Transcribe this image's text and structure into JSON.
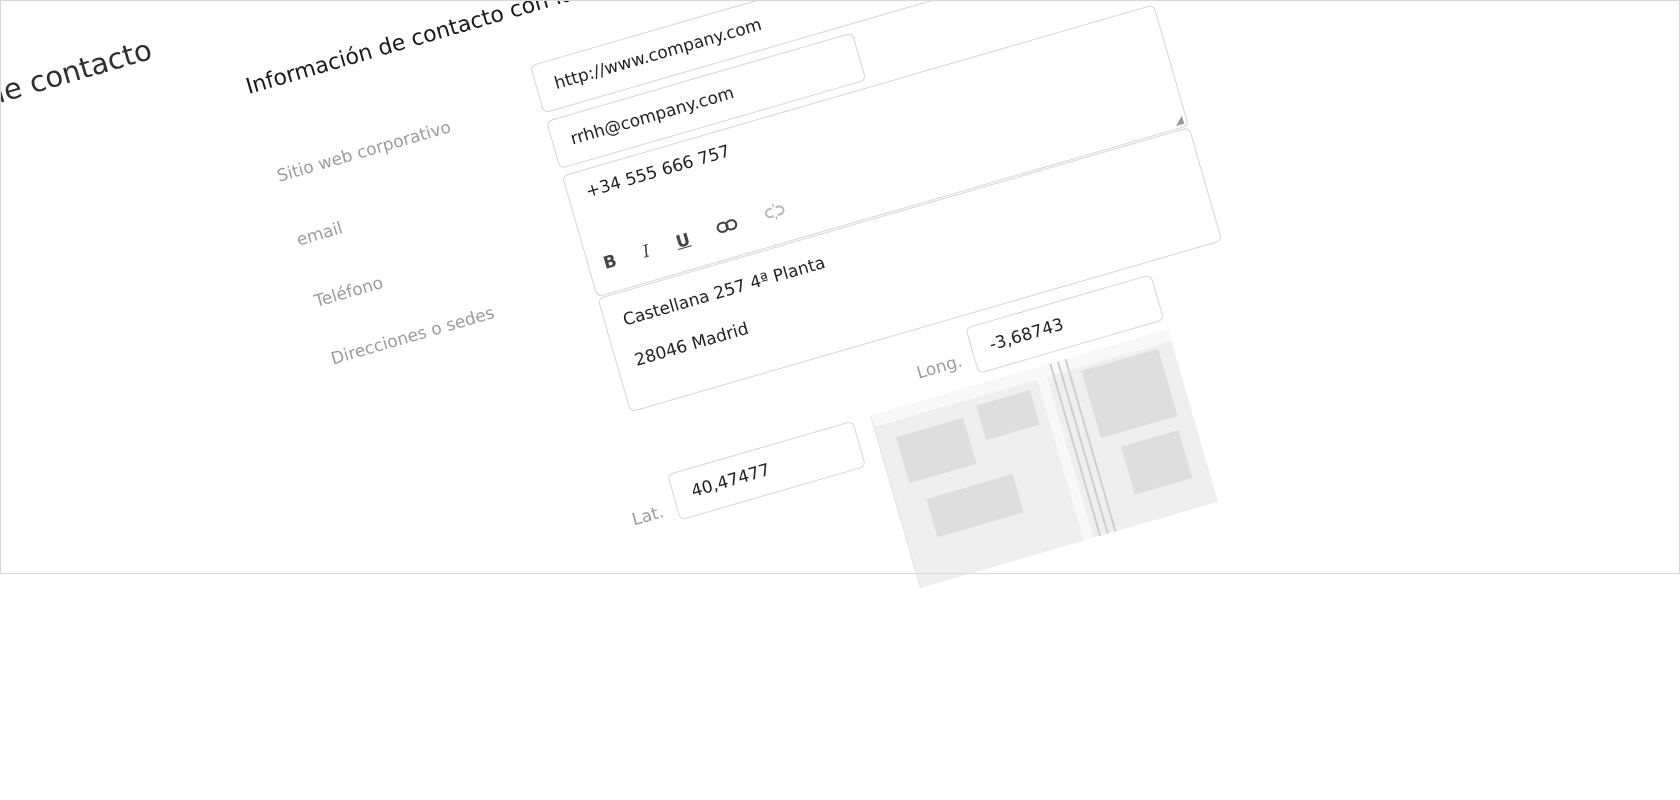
{
  "page": {
    "title": "de contacto"
  },
  "section": {
    "title": "Información de contacto con la empresa"
  },
  "form": {
    "website": {
      "label": "Sitio web corporativo",
      "value": "http://www.company.com"
    },
    "email": {
      "label": "email",
      "value": "rrhh@company.com"
    },
    "phone": {
      "label": "Teléfono",
      "value": "+34 555 666 757"
    },
    "address": {
      "label": "Direcciones o sedes",
      "toolbar": {
        "bold": "B",
        "italic": "I",
        "underline": "U"
      },
      "lines": [
        "Castellana 257 4ª Planta",
        "28046 Madrid"
      ]
    },
    "longitude": {
      "label": "Long.",
      "value": "-3,68743"
    },
    "latitude": {
      "label": "Lat.",
      "value": "40,47477"
    }
  }
}
